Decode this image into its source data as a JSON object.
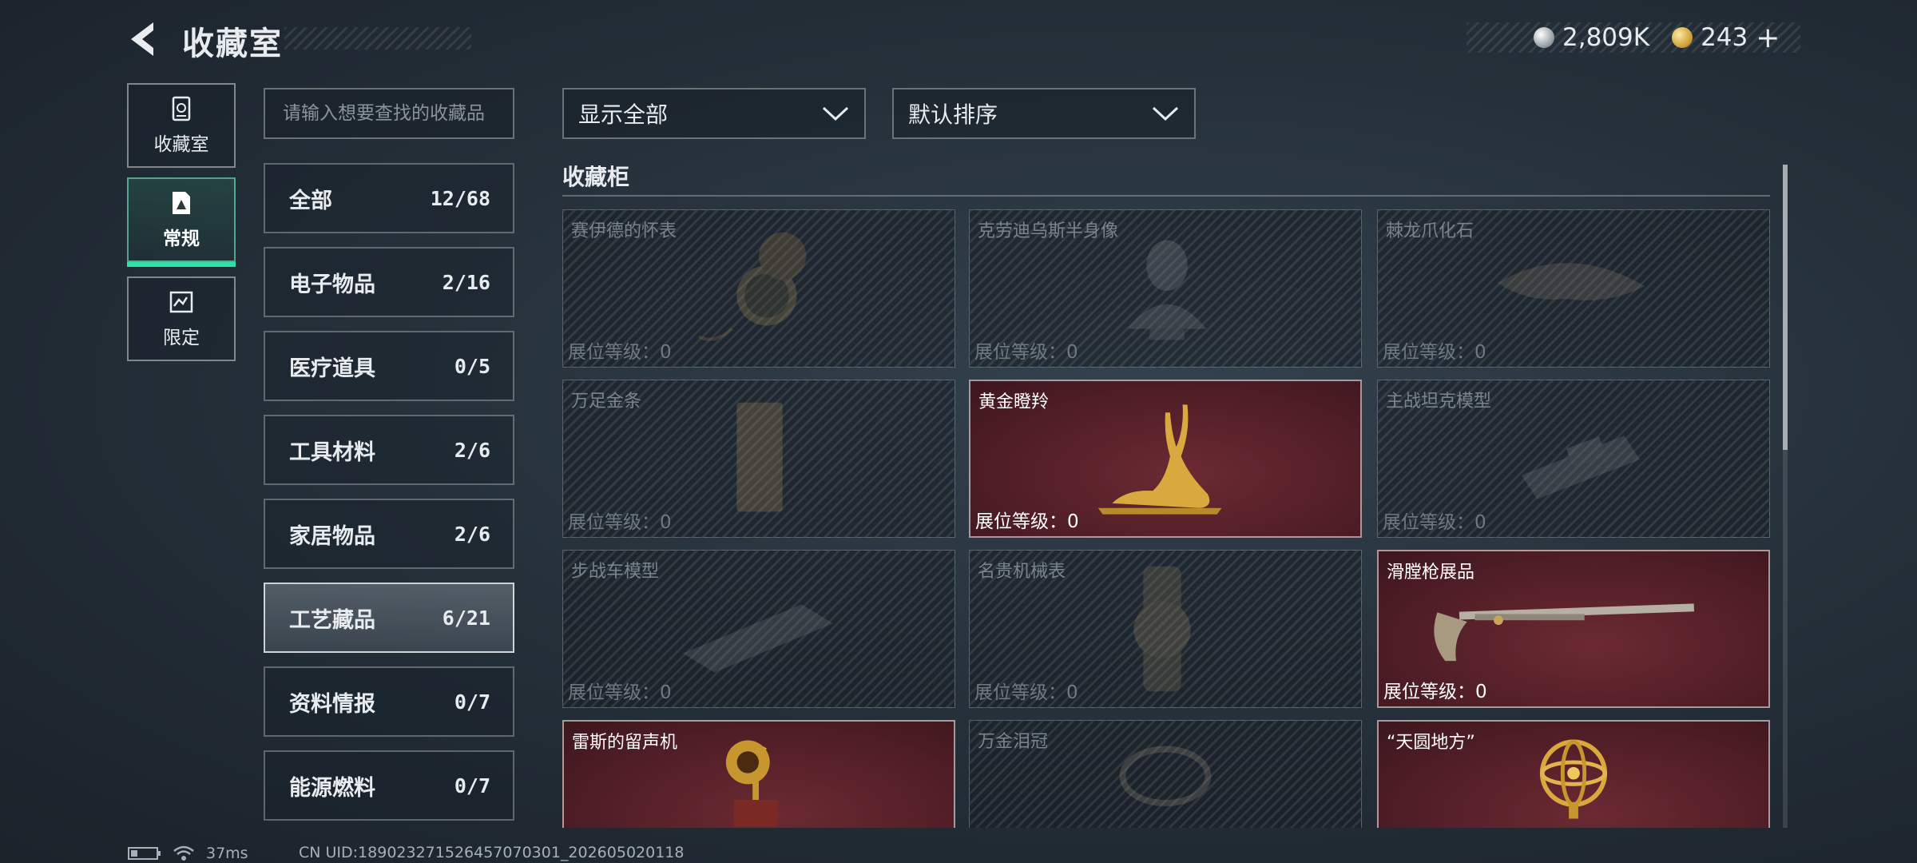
{
  "header": {
    "title": "收藏室",
    "currency": {
      "silver": "2,809K",
      "gold": "243",
      "add": "+"
    }
  },
  "nav": [
    {
      "label": "收藏室",
      "icon": "vault-icon"
    },
    {
      "label": "常规",
      "icon": "regular-collection-icon"
    },
    {
      "label": "限定",
      "icon": "limited-collection-icon"
    }
  ],
  "search": {
    "placeholder": "请输入想要查找的收藏品"
  },
  "categories": [
    {
      "label": "全部",
      "count": "12/68"
    },
    {
      "label": "电子物品",
      "count": "2/16"
    },
    {
      "label": "医疗道具",
      "count": "0/5"
    },
    {
      "label": "工具材料",
      "count": "2/6"
    },
    {
      "label": "家居物品",
      "count": "2/6"
    },
    {
      "label": "工艺藏品",
      "count": "6/21"
    },
    {
      "label": "资料情报",
      "count": "0/7"
    },
    {
      "label": "能源燃料",
      "count": "0/7"
    }
  ],
  "filters": {
    "display": "显示全部",
    "sort": "默认排序"
  },
  "section": {
    "title": "收藏柜"
  },
  "level_prefix": "展位等级：",
  "items": [
    {
      "name": "赛伊德的怀表",
      "level": "0",
      "owned": false,
      "icon": "pocket-watch-icon"
    },
    {
      "name": "克劳迪乌斯半身像",
      "level": "0",
      "owned": false,
      "icon": "bust-statue-icon"
    },
    {
      "name": "棘龙爪化石",
      "level": "0",
      "owned": false,
      "icon": "claw-fossil-icon"
    },
    {
      "name": "万足金条",
      "level": "0",
      "owned": false,
      "icon": "gold-bar-icon"
    },
    {
      "name": "黄金瞪羚",
      "level": "0",
      "owned": true,
      "icon": "golden-gazelle-icon"
    },
    {
      "name": "主战坦克模型",
      "level": "0",
      "owned": false,
      "icon": "tank-model-icon"
    },
    {
      "name": "步战车模型",
      "level": "0",
      "owned": false,
      "icon": "ifv-model-icon"
    },
    {
      "name": "名贵机械表",
      "level": "0",
      "owned": false,
      "icon": "wristwatch-icon"
    },
    {
      "name": "滑膛枪展品",
      "level": "0",
      "owned": true,
      "icon": "musket-icon"
    },
    {
      "name": "雷斯的留声机",
      "level": "",
      "owned": true,
      "icon": "gramophone-icon"
    },
    {
      "name": "万金泪冠",
      "level": "",
      "owned": false,
      "icon": "tiara-icon"
    },
    {
      "name": "“天圆地方”",
      "level": "",
      "owned": true,
      "icon": "armillary-sphere-icon"
    }
  ],
  "status": {
    "ping": "37ms",
    "uid": "CN UID:18902327152645707030​1_202605020118"
  },
  "scroll": {
    "position": 0,
    "visible_fraction": 0.43
  },
  "colors": {
    "accent": "#2fe0a7",
    "owned_card": "#4c1c24"
  }
}
